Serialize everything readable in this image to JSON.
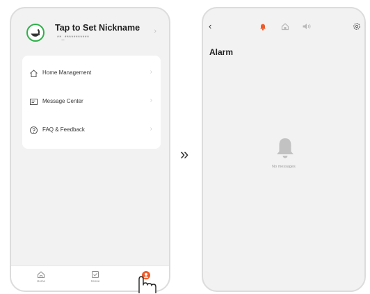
{
  "profile": {
    "nickname": "Tap to Set Nickname",
    "account": "**_***********",
    "chevron": "›"
  },
  "menu": [
    {
      "label": "Home Management",
      "icon": "house-icon"
    },
    {
      "label": "Message Center",
      "icon": "message-icon"
    },
    {
      "label": "FAQ & Feedback",
      "icon": "help-circle-icon"
    }
  ],
  "menu_chevron": "›",
  "tabbar": [
    {
      "label": "Home",
      "icon": "home-icon"
    },
    {
      "label": "Scene",
      "icon": "scene-checkbox-icon"
    },
    {
      "label": "",
      "icon": "me-icon"
    }
  ],
  "arrow": "»",
  "alarm_screen": {
    "back": "‹",
    "title": "Alarm",
    "empty_text": "No messages",
    "tabs": [
      "alarm-bell-icon",
      "home-tab-icon",
      "speaker-icon"
    ],
    "settings_icon": "gear-icon"
  },
  "colors": {
    "accent": "#f05a28",
    "logo_green": "#2fb14a",
    "muted_icon": "#b9b9b9",
    "bell_gray": "#c2c2c2"
  }
}
